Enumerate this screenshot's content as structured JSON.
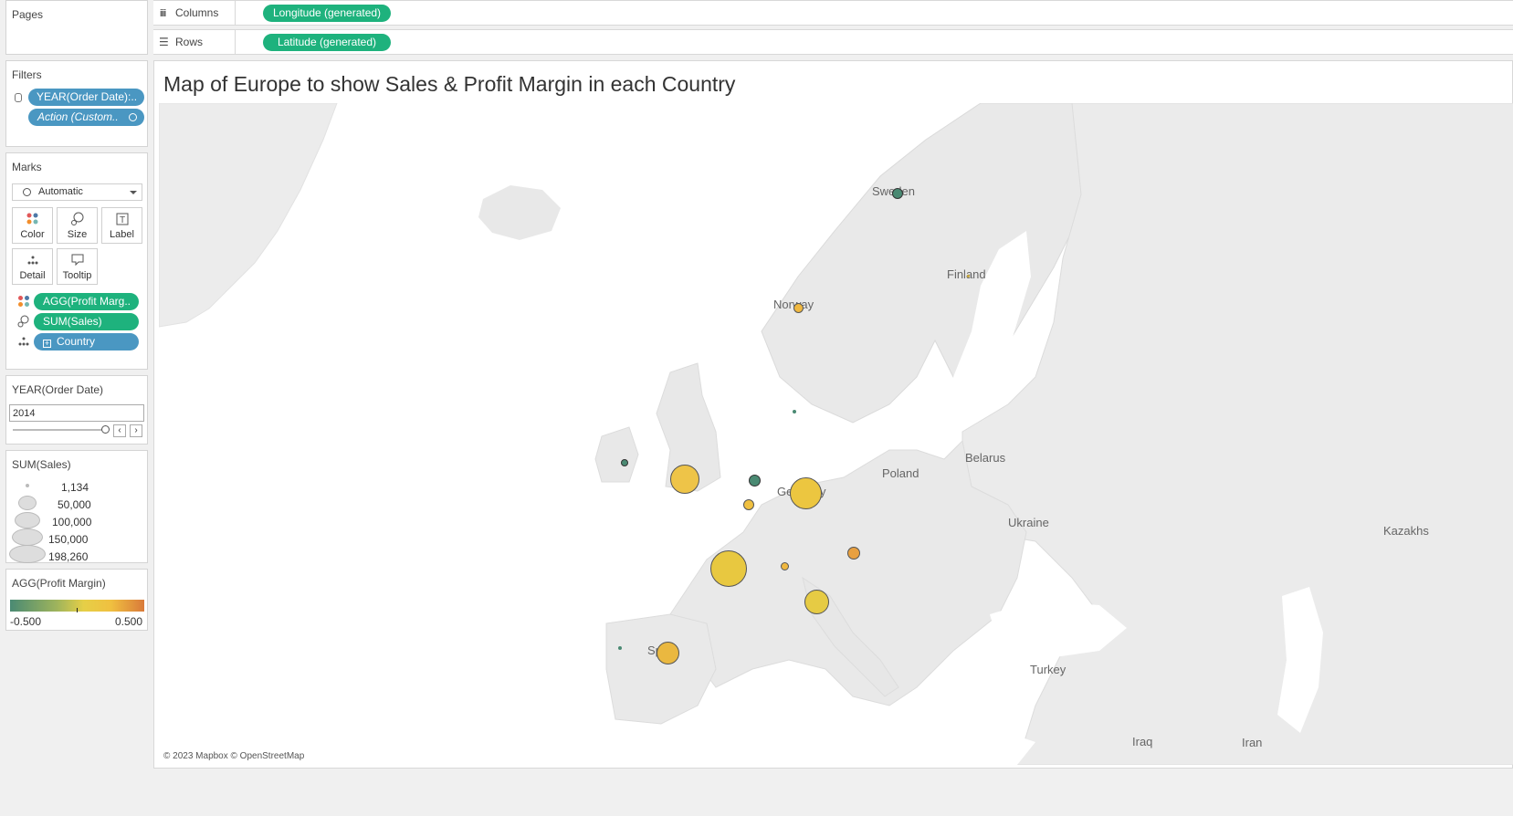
{
  "pages": {
    "title": "Pages"
  },
  "shelves": {
    "columns": {
      "label": "Columns",
      "pill": "Longitude (generated)"
    },
    "rows": {
      "label": "Rows",
      "pill": "Latitude (generated)"
    }
  },
  "filters": {
    "title": "Filters",
    "items": [
      "YEAR(Order Date):..",
      "Action (Custom.."
    ]
  },
  "marks": {
    "title": "Marks",
    "type_selected": "Automatic",
    "buttons": [
      "Color",
      "Size",
      "Label",
      "Detail",
      "Tooltip"
    ],
    "fields": [
      "AGG(Profit Marg..",
      "SUM(Sales)",
      "Country"
    ]
  },
  "year_filter": {
    "title": "YEAR(Order Date)",
    "value": "2014"
  },
  "size_legend": {
    "title": "SUM(Sales)",
    "values": [
      "1,134",
      "50,000",
      "100,000",
      "150,000",
      "198,260"
    ]
  },
  "color_legend": {
    "title": "AGG(Profit Margin)",
    "min": "-0.500",
    "max": "0.500",
    "colors": [
      "#4a8a73",
      "#d9d44a",
      "#f0c040",
      "#d97a3a"
    ]
  },
  "view": {
    "title": "Map of Europe to show Sales & Profit Margin in each Country",
    "attribution": "© 2023 Mapbox © OpenStreetMap",
    "place_labels": [
      "Sweden",
      "Finland",
      "Norway",
      "Belarus",
      "Poland",
      "Ukraine",
      "Kazakhs",
      "Turkey",
      "Iraq",
      "Iran",
      "Spain",
      "Germany"
    ]
  }
}
